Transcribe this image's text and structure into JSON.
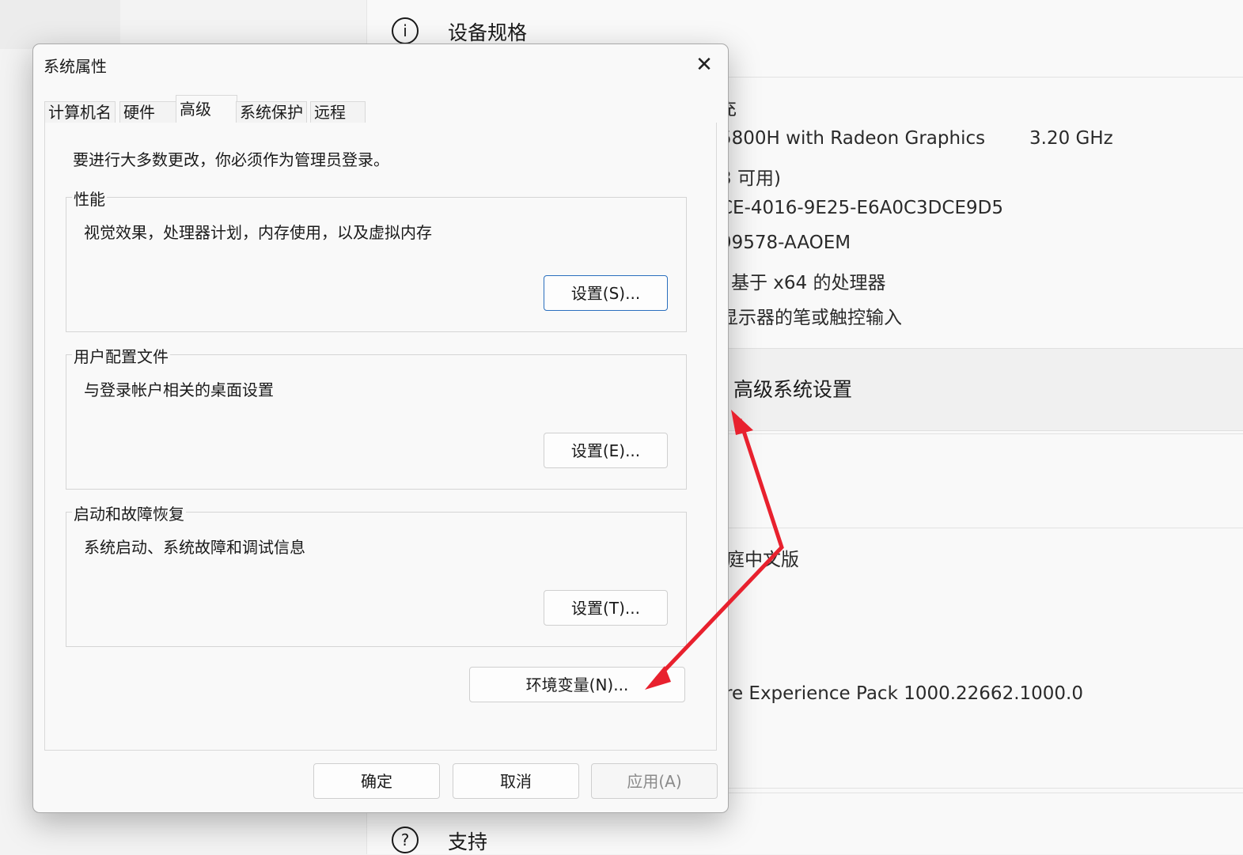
{
  "background": {
    "spec_title": "设备规格",
    "spec_rows": [
      {
        "text": "充",
        "class": "r0"
      },
      {
        "text": "5800H with Radeon Graphics",
        "class": "r1"
      },
      {
        "text": "3.20 GHz",
        "class": "r1b"
      },
      {
        "text": "3 可用)",
        "class": "r2"
      },
      {
        "text": "CE-4016-9E25-E6A0C3DCE9D5",
        "class": "r3"
      },
      {
        "text": "99578-AAOEM",
        "class": "r4"
      },
      {
        "text": "基于 x64 的处理器",
        "class": "r5"
      },
      {
        "text": "显示器的笔或触控输入",
        "class": "r6"
      }
    ],
    "advanced_link": "高级系统设置",
    "edition_partial": "庭中文版",
    "experience_partial": "re Experience Pack 1000.22662.1000.0",
    "support_title": "支持"
  },
  "dialog": {
    "title": "系统属性",
    "tabs": [
      "计算机名",
      "硬件",
      "高级",
      "系统保护",
      "远程"
    ],
    "active_tab": "高级",
    "admin_note": "要进行大多数更改，你必须作为管理员登录。",
    "groups": [
      {
        "label": "性能",
        "desc": "视觉效果，处理器计划，内存使用，以及虚拟内存",
        "button": "设置(S)..."
      },
      {
        "label": "用户配置文件",
        "desc": "与登录帐户相关的桌面设置",
        "button": "设置(E)..."
      },
      {
        "label": "启动和故障恢复",
        "desc": "系统启动、系统故障和调试信息",
        "button": "设置(T)..."
      }
    ],
    "env_button": "环境变量(N)...",
    "ok": "确定",
    "cancel": "取消",
    "apply": "应用(A)"
  },
  "icons": {
    "info": "i",
    "help": "?",
    "close": "✕"
  },
  "colors": {
    "annotation_arrow": "#e8212e",
    "primary_border": "#2a6fbe"
  }
}
